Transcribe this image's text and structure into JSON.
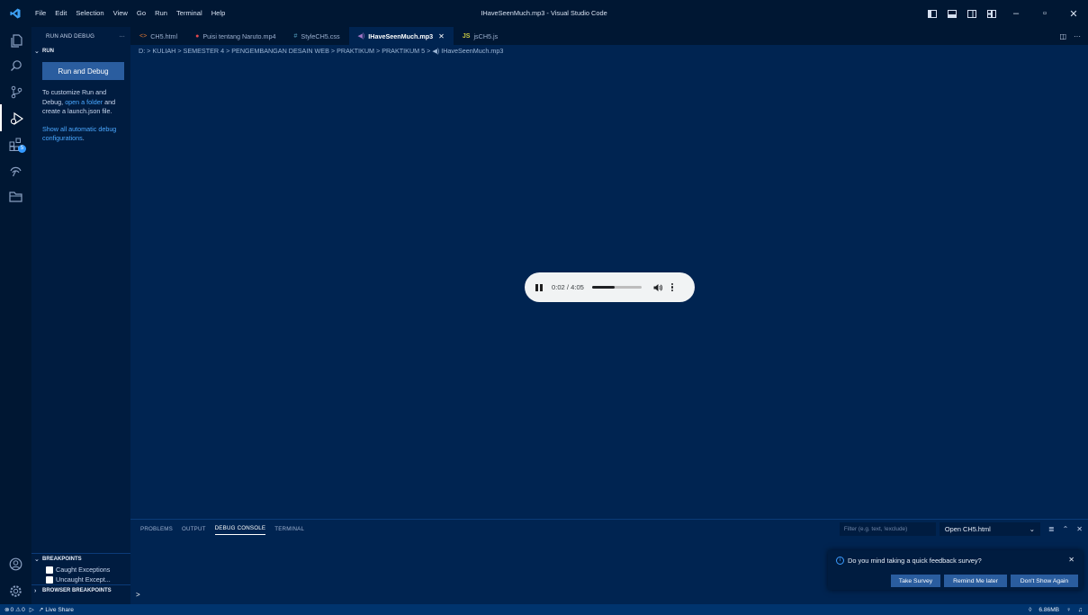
{
  "window": {
    "title": "IHaveSeenMuch.mp3 - Visual Studio Code",
    "menu": [
      "File",
      "Edit",
      "Selection",
      "View",
      "Go",
      "Run",
      "Terminal",
      "Help"
    ]
  },
  "sidebar": {
    "view_title": "RUN AND DEBUG",
    "section_run": "RUN",
    "run_button": "Run and Debug",
    "help_text_1": "To customize Run and Debug, ",
    "help_link": "open a folder",
    "help_text_2": " and create a launch.json file.",
    "show_all_link": "Show all automatic debug configurations",
    "show_all_suffix": ".",
    "breakpoints_title": "BREAKPOINTS",
    "breakpoints": [
      "Caught Exceptions",
      "Uncaught Except..."
    ],
    "browser_breakpoints_title": "BROWSER BREAKPOINTS"
  },
  "activity": {
    "extensions_badge": "5"
  },
  "tabs": [
    {
      "label": "CH5.html",
      "icon": "<>",
      "icon_color": "#e37933"
    },
    {
      "label": "Puisi tentang Naruto.mp4",
      "icon": "●",
      "icon_color": "#e5484d"
    },
    {
      "label": "StyleCH5.css",
      "icon": "#",
      "icon_color": "#519aba"
    },
    {
      "label": "IHaveSeenMuch.mp3",
      "icon": "◀)",
      "icon_color": "#a074c4"
    },
    {
      "label": "jsCH5.js",
      "icon": "JS",
      "icon_color": "#cbcb41"
    }
  ],
  "breadcrumb": "D: > KULIAH > SEMESTER 4 > PENGEMBANGAN DESAIN WEB > PRAKTIKUM > PRAKTIKUM 5 > ◀) IHaveSeenMuch.mp3",
  "audio": {
    "time": "0:02 / 4:05",
    "progress": 0.45
  },
  "panel": {
    "tabs": [
      "PROBLEMS",
      "OUTPUT",
      "DEBUG CONSOLE",
      "TERMINAL"
    ],
    "filter_placeholder": "Filter (e.g. text, !exclude)",
    "select_value": "Open CH5.html",
    "prompt": ">"
  },
  "notification": {
    "message": "Do you mind taking a quick feedback survey?",
    "buttons": [
      "Take Survey",
      "Remind Me later",
      "Don't Show Again"
    ]
  },
  "status": {
    "errors": "0",
    "warnings": "0",
    "live_share": "Live Share",
    "memory": "6.86MB"
  }
}
